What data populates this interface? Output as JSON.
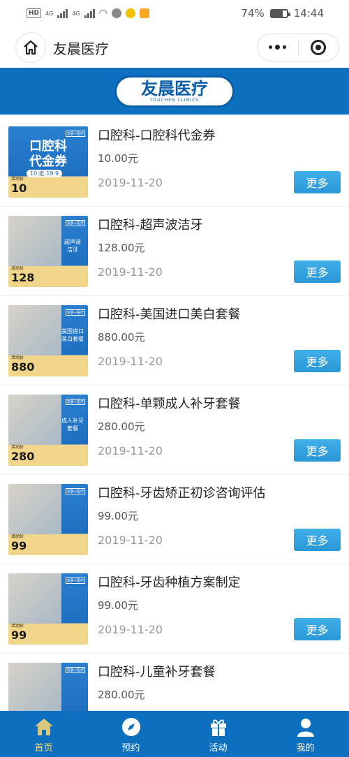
{
  "status_bar": {
    "left_chips": [
      "HD",
      "4G",
      "4G"
    ],
    "battery": "74%",
    "time": "14:44"
  },
  "header": {
    "title": "友晨医疗"
  },
  "banner": {
    "logo_text": "友晨医疗",
    "logo_sub": "YOUCHEN CLINICS"
  },
  "colors": {
    "brand_blue": "#0d6fbf",
    "more_button": "#2a97d6",
    "tab_active": "#ffd966"
  },
  "items": [
    {
      "title": "口腔科-口腔科代金券",
      "price": "10.00元",
      "date": "2019-11-20",
      "more": "更多",
      "thumb": {
        "style": "big",
        "text": "口腔科\n代金券",
        "pill": "10 抵 19.9",
        "price_label": "活动价",
        "price": "10",
        "tag": "友晨+医疗"
      }
    },
    {
      "title": "口腔科-超声波洁牙",
      "price": "128.00元",
      "date": "2019-11-20",
      "more": "更多",
      "thumb": {
        "style": "photo",
        "text": "超声波\n洁牙",
        "price_label": "活动价",
        "price": "128",
        "tag": "友晨+医疗"
      }
    },
    {
      "title": "口腔科-美国进口美白套餐",
      "price": "880.00元",
      "date": "2019-11-20",
      "more": "更多",
      "thumb": {
        "style": "photo",
        "text": "美国进口\n美白套餐",
        "price_label": "活动价",
        "price": "880",
        "tag": "友晨+医疗"
      }
    },
    {
      "title": "口腔科-单颗成人补牙套餐",
      "price": "280.00元",
      "date": "2019-11-20",
      "more": "更多",
      "thumb": {
        "style": "photo",
        "text": "成人补牙\n套餐",
        "price_label": "活动价",
        "price": "280",
        "tag": "友晨+医疗"
      }
    },
    {
      "title": "口腔科-牙齿矫正初诊咨询评估",
      "price": "99.00元",
      "date": "2019-11-20",
      "more": "更多",
      "thumb": {
        "style": "photo",
        "text": "",
        "price_label": "活动价",
        "price": "99",
        "tag": "友晨+医疗"
      }
    },
    {
      "title": "口腔科-牙齿种植方案制定",
      "price": "99.00元",
      "date": "2019-11-20",
      "more": "更多",
      "thumb": {
        "style": "photo",
        "text": "",
        "price_label": "活动价",
        "price": "99",
        "tag": "友晨+医疗"
      }
    },
    {
      "title": "口腔科-儿童补牙套餐",
      "price": "280.00元",
      "date": "",
      "more": "",
      "thumb": {
        "style": "photo",
        "text": "",
        "price_label": "",
        "price": "",
        "tag": "友晨+医疗"
      }
    }
  ],
  "tabbar": [
    {
      "label": "首页",
      "icon": "home-icon",
      "active": true
    },
    {
      "label": "预约",
      "icon": "compass-icon",
      "active": false
    },
    {
      "label": "活动",
      "icon": "gift-icon",
      "active": false
    },
    {
      "label": "我的",
      "icon": "user-icon",
      "active": false
    }
  ]
}
